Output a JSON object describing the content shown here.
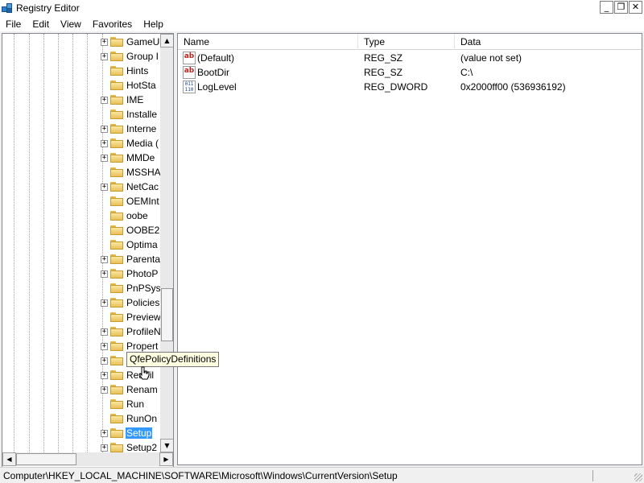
{
  "window": {
    "title": "Registry Editor",
    "controls": {
      "minimize": "_",
      "maximize": "❐",
      "close": "✕"
    }
  },
  "menu": [
    "File",
    "Edit",
    "View",
    "Favorites",
    "Help"
  ],
  "tree": {
    "items": [
      {
        "label": "GameU",
        "expandable": true
      },
      {
        "label": "Group I",
        "expandable": true
      },
      {
        "label": "Hints",
        "expandable": false
      },
      {
        "label": "HotSta",
        "expandable": false
      },
      {
        "label": "IME",
        "expandable": true
      },
      {
        "label": "Installe",
        "expandable": false
      },
      {
        "label": "Interne",
        "expandable": true
      },
      {
        "label": "Media (",
        "expandable": true
      },
      {
        "label": "MMDe",
        "expandable": true
      },
      {
        "label": "MSSHA",
        "expandable": false
      },
      {
        "label": "NetCac",
        "expandable": true
      },
      {
        "label": "OEMInt",
        "expandable": false
      },
      {
        "label": "oobe",
        "expandable": false
      },
      {
        "label": "OOBE2",
        "expandable": false
      },
      {
        "label": "Optima",
        "expandable": false
      },
      {
        "label": "Parenta",
        "expandable": true
      },
      {
        "label": "PhotoP",
        "expandable": true
      },
      {
        "label": "PnPSys",
        "expandable": false
      },
      {
        "label": "Policies",
        "expandable": true
      },
      {
        "label": "Preview",
        "expandable": false
      },
      {
        "label": "ProfileN",
        "expandable": true
      },
      {
        "label": "Propert",
        "expandable": true
      },
      {
        "label": "QfePolicyDefinitions",
        "expandable": true
      },
      {
        "label": "Reabil",
        "expandable": true
      },
      {
        "label": "Renam",
        "expandable": true
      },
      {
        "label": "Run",
        "expandable": false
      },
      {
        "label": "RunOn",
        "expandable": false
      },
      {
        "label": "Setup",
        "expandable": true,
        "selected": true
      },
      {
        "label": "Setup2",
        "expandable": true
      }
    ],
    "scroll_up": "▲",
    "scroll_down": "▼",
    "scroll_left": "◀",
    "scroll_right": "▶"
  },
  "tooltip": "QfePolicyDefinitions",
  "list": {
    "columns": [
      "Name",
      "Type",
      "Data"
    ],
    "rows": [
      {
        "icon": "string-value-icon",
        "icon_text": "ab",
        "name": "(Default)",
        "type": "REG_SZ",
        "data": "(value not set)"
      },
      {
        "icon": "string-value-icon",
        "icon_text": "ab",
        "name": "BootDir",
        "type": "REG_SZ",
        "data": "C:\\"
      },
      {
        "icon": "dword-value-icon",
        "icon_text": "011 110",
        "name": "LogLevel",
        "type": "REG_DWORD",
        "data": "0x2000ff00 (536936192)"
      }
    ]
  },
  "status": {
    "path": "Computer\\HKEY_LOCAL_MACHINE\\SOFTWARE\\Microsoft\\Windows\\CurrentVersion\\Setup"
  },
  "colors": {
    "selection": "#3399ff",
    "tooltip_bg": "#ffffe1",
    "folder": "#e8c15a"
  }
}
